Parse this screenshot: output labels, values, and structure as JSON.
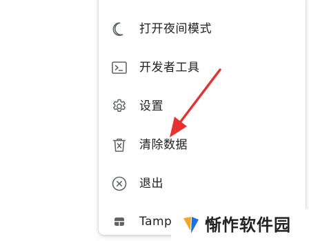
{
  "menu": {
    "items": [
      {
        "label": "打开夜间模式",
        "icon": "moon-icon"
      },
      {
        "label": "开发者工具",
        "icon": "terminal-icon"
      },
      {
        "label": "设置",
        "icon": "gear-icon"
      },
      {
        "label": "清除数据",
        "icon": "trash-icon"
      },
      {
        "label": "退出",
        "icon": "close-circle-icon"
      },
      {
        "label": "Tamp",
        "icon": "tampermonkey-icon"
      }
    ]
  },
  "watermark": {
    "text": "惭怍软件园",
    "icon": "watermark-logo-icon"
  },
  "colors": {
    "icon": "#5f6368",
    "text": "#202124",
    "arrow": "#e8312f",
    "logo_orange": "#f5a623",
    "logo_blue": "#1a73e8"
  }
}
